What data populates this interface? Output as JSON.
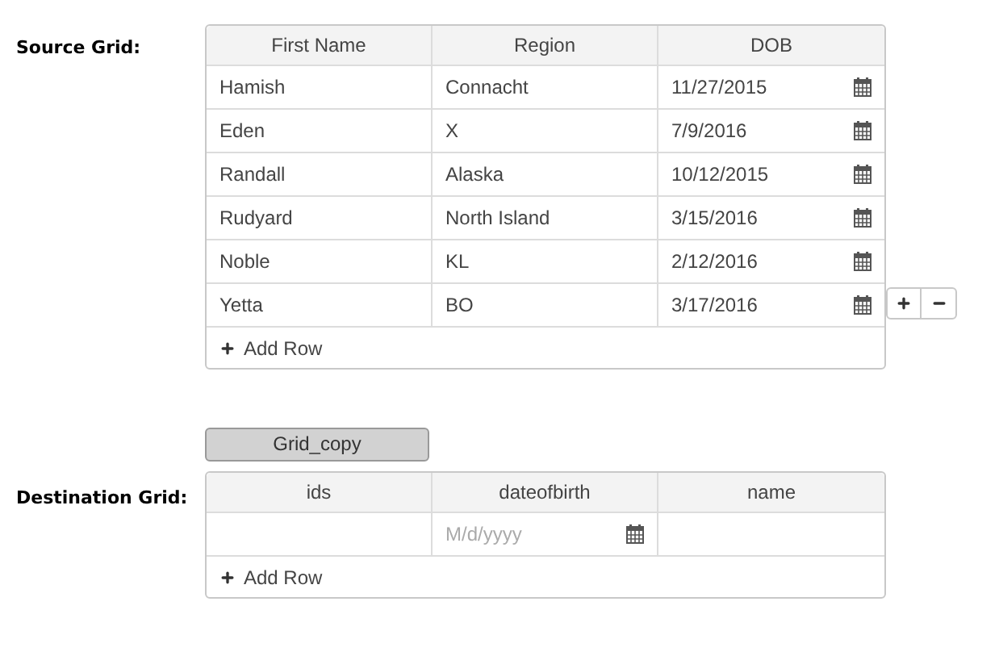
{
  "source_grid": {
    "label": "Source Grid:",
    "columns": [
      {
        "title": "First Name",
        "kind": "text"
      },
      {
        "title": "Region",
        "kind": "text"
      },
      {
        "title": "DOB",
        "kind": "date"
      }
    ],
    "rows": [
      {
        "cells": [
          "Hamish",
          "Connacht",
          "11/27/2015"
        ]
      },
      {
        "cells": [
          "Eden",
          "X",
          "7/9/2016"
        ]
      },
      {
        "cells": [
          "Randall",
          "Alaska",
          "10/12/2015"
        ]
      },
      {
        "cells": [
          "Rudyard",
          "North Island",
          "3/15/2016"
        ]
      },
      {
        "cells": [
          "Noble",
          "KL",
          "2/12/2016"
        ]
      },
      {
        "cells": [
          "Yetta",
          "BO",
          "3/17/2016"
        ]
      }
    ],
    "row_actions_visible": true,
    "add_row": "Add Row"
  },
  "copy_button": "Grid_copy",
  "destination_grid": {
    "label": "Destination Grid:",
    "columns": [
      {
        "title": "ids",
        "kind": "text"
      },
      {
        "title": "dateofbirth",
        "kind": "date"
      },
      {
        "title": "name",
        "kind": "text"
      }
    ],
    "rows": [
      {
        "cells": [
          {},
          {
            "placeholder": "M/d/yyyy"
          },
          {}
        ]
      }
    ],
    "add_row": "Add Row"
  }
}
